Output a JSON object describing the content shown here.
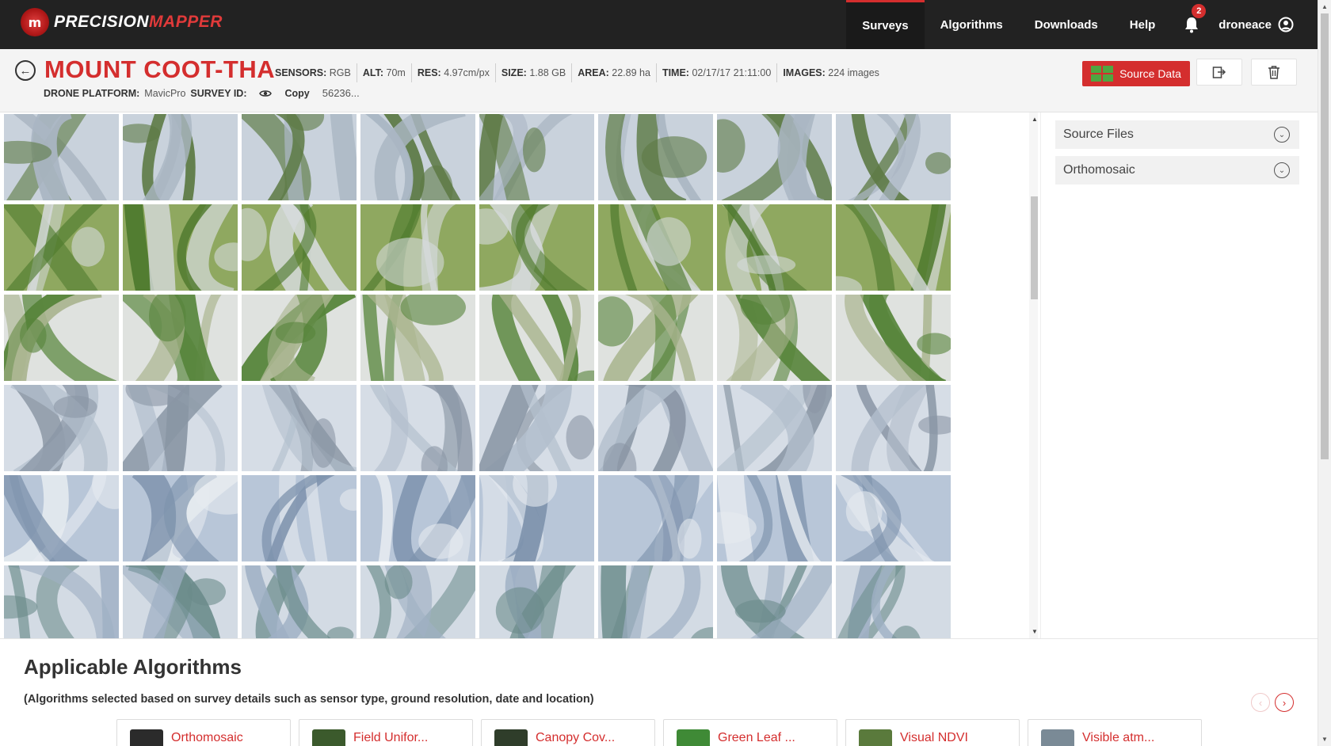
{
  "brand": {
    "logo_left": "PRECISION",
    "logo_right": "MAPPER",
    "logo_glyph": "m"
  },
  "nav": {
    "items": [
      {
        "label": "Surveys",
        "active": true
      },
      {
        "label": "Algorithms",
        "active": false
      },
      {
        "label": "Downloads",
        "active": false
      },
      {
        "label": "Help",
        "active": false
      }
    ],
    "notifications_count": "2",
    "username": "droneace"
  },
  "survey": {
    "title": "MOUNT COOT-THA",
    "meta": [
      {
        "label": "SENSORS:",
        "value": "RGB"
      },
      {
        "label": "ALT:",
        "value": "70m"
      },
      {
        "label": "RES:",
        "value": "4.97cm/px"
      },
      {
        "label": "SIZE:",
        "value": "1.88 GB"
      },
      {
        "label": "AREA:",
        "value": "22.89 ha"
      },
      {
        "label": "TIME:",
        "value": "02/17/17 21:11:00"
      },
      {
        "label": "IMAGES:",
        "value": "224 images"
      }
    ],
    "platform_label": "DRONE PLATFORM:",
    "platform_value": "MavicPro",
    "survey_id_label": "SURVEY ID:",
    "copy_label": "Copy",
    "survey_id_value": "56236...",
    "source_data_label": "Source Data"
  },
  "icons": {
    "back": "back-arrow-icon",
    "eye": "eye-icon",
    "export": "export-icon",
    "trash": "trash-icon",
    "bell": "bell-icon",
    "user": "user-icon"
  },
  "side_panel": {
    "sections": [
      {
        "label": "Source Files"
      },
      {
        "label": "Orthomosaic"
      }
    ]
  },
  "algorithms": {
    "title": "Applicable Algorithms",
    "subtitle": "(Algorithms selected based on survey details such as sensor type, ground resolution, date and location)",
    "cards": [
      {
        "label": "Orthomosaic",
        "icon_color": "#2b2b2b"
      },
      {
        "label": "Field Unifor...",
        "icon_color": "#3b5a2c"
      },
      {
        "label": "Canopy Cov...",
        "icon_color": "#2f3d2a"
      },
      {
        "label": "Green Leaf ...",
        "icon_color": "#3f8a36"
      },
      {
        "label": "Visual NDVI",
        "icon_color": "#5a7a3c"
      },
      {
        "label": "Visible atm...",
        "icon_color": "#7a8a96"
      }
    ]
  },
  "colors": {
    "accent": "#d42e2e",
    "nav_bg": "#222222"
  }
}
